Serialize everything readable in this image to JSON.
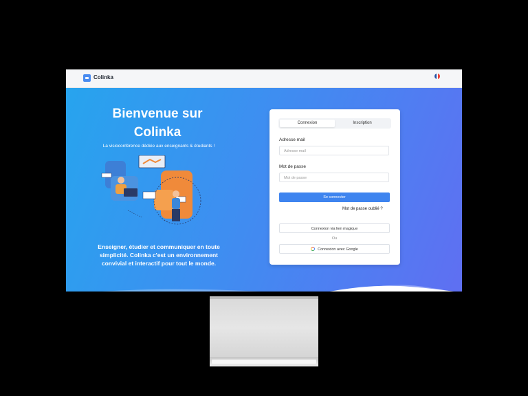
{
  "app": {
    "name": "Colinka",
    "logo_icon": "video-camera-icon",
    "language_flag": "french-flag-icon"
  },
  "hero": {
    "title": "Bienvenue sur Colinka",
    "subtitle": "La visioconférence dédiée aux enseignants & étudiants !",
    "description": "Enseigner, étudier et communiquer en toute simplicité. Colinka c'est un environnement convivial et interactif pour tout le monde."
  },
  "auth": {
    "tabs": [
      {
        "label": "Connexion",
        "active": true
      },
      {
        "label": "Inscription",
        "active": false
      }
    ],
    "email": {
      "label": "Adresse mail",
      "placeholder": "Adresse mail"
    },
    "password": {
      "label": "Mot de passe",
      "placeholder": "Mot de passe"
    },
    "submit_label": "Se connecter",
    "forgot_label": "Mot de passe oublié ?",
    "magic_link_label": "Connexion via lien magique",
    "or_label": "Ou",
    "google_label": "Connexion avec Google"
  },
  "colors": {
    "accent": "#3e84ef",
    "hero_start": "#27a4ee",
    "hero_end": "#5f6ff2"
  }
}
